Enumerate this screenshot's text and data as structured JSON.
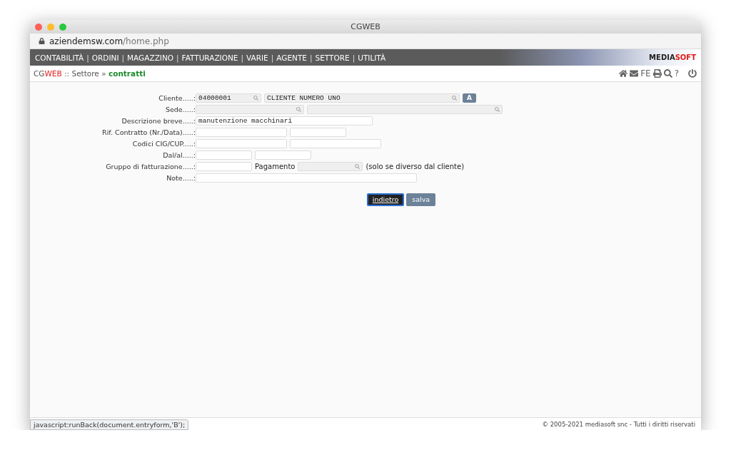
{
  "window": {
    "title": "CGWEB"
  },
  "url": {
    "host": "aziendemsw.com",
    "path": "/home.php"
  },
  "menu": {
    "separator": "|",
    "items": [
      {
        "label": "CONTABILITÀ"
      },
      {
        "label": "ORDINI"
      },
      {
        "label": "MAGAZZINO"
      },
      {
        "label": "FATTURAZIONE"
      },
      {
        "label": "VARIE"
      },
      {
        "label": "AGENTE"
      },
      {
        "label": "SETTORE"
      },
      {
        "label": "UTILITÀ"
      }
    ],
    "brand": [
      "MEDIA",
      "SOFT"
    ]
  },
  "breadcrumb": {
    "app": [
      "CG",
      "WEB"
    ],
    "separator": "::",
    "section": "Settore",
    "arrow": "»",
    "current": "contratti"
  },
  "toolbar": [
    {
      "kind": "icon"
    },
    {
      "kind": "icon"
    },
    {
      "kind": "text",
      "label": "FE"
    },
    {
      "kind": "icon"
    },
    {
      "kind": "icon"
    },
    {
      "kind": "text",
      "label": "?"
    },
    {
      "kind": "icon"
    }
  ],
  "form": [
    {
      "label": "Cliente.....:",
      "fields": [
        {
          "kind": "lookup",
          "value": "04000001"
        },
        {
          "kind": "lookup",
          "value": "CLIENTE NUMERO UNO"
        },
        {
          "kind": "button",
          "label": "A"
        }
      ]
    },
    {
      "label": "Sede.....:",
      "fields": [
        {
          "kind": "lookup"
        },
        {
          "kind": "lookup"
        }
      ]
    },
    {
      "label": "Descrizione breve.....:",
      "fields": [
        {
          "kind": "text",
          "value": "manutenzione macchinari"
        }
      ]
    },
    {
      "label": "Rif. Contratto (Nr./Data).....:",
      "fields": [
        {
          "kind": "text"
        },
        {
          "kind": "text"
        }
      ]
    },
    {
      "label": "Codici CIG/CUP.....:",
      "fields": [
        {
          "kind": "text"
        },
        {
          "kind": "text"
        }
      ]
    },
    {
      "label": "Dal/al.....:",
      "fields": [
        {
          "kind": "text"
        },
        {
          "kind": "text"
        }
      ]
    },
    {
      "label": "Gruppo di fatturazione.....:",
      "fields": [
        {
          "kind": "text"
        },
        {
          "kind": "label",
          "label": "Pagamento"
        },
        {
          "kind": "lookup"
        },
        {
          "kind": "note",
          "label": "(solo se diverso dal cliente)"
        }
      ]
    },
    {
      "label": "Note.....:",
      "fields": [
        {
          "kind": "text"
        }
      ]
    }
  ],
  "buttons": [
    {
      "label": "indietro",
      "focused": true
    },
    {
      "label": "salva",
      "focused": false
    }
  ],
  "footer": "© 2005-2021 mediasoft snc - Tutti i diritti riservati",
  "status_bar": "javascript:runBack(document.entryform,'B');"
}
